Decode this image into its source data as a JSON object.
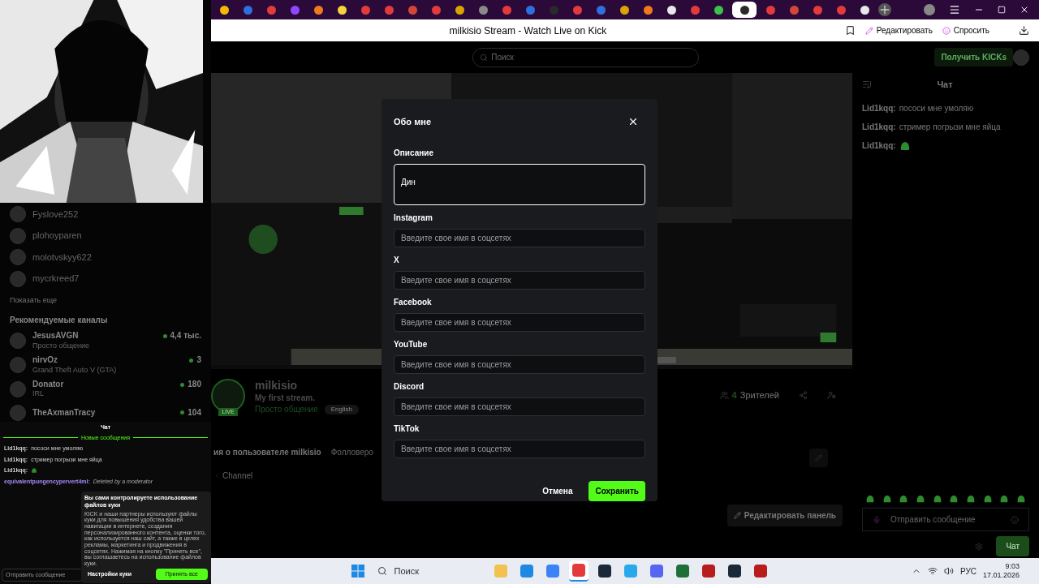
{
  "browser": {
    "tabs": [
      {
        "kind": "star",
        "selected": false
      },
      {
        "kind": "blue",
        "selected": false
      },
      {
        "kind": "ya",
        "selected": false
      },
      {
        "kind": "purple",
        "selected": false
      },
      {
        "kind": "orange",
        "selected": false
      },
      {
        "kind": "yellow",
        "selected": false
      },
      {
        "kind": "ya",
        "selected": false
      },
      {
        "kind": "ya",
        "selected": false
      },
      {
        "kind": "mail",
        "selected": false
      },
      {
        "kind": "ya",
        "selected": false
      },
      {
        "kind": "gold",
        "selected": false
      },
      {
        "kind": "grey",
        "selected": false
      },
      {
        "kind": "ya",
        "selected": false
      },
      {
        "kind": "blue",
        "selected": false
      },
      {
        "kind": "dark",
        "selected": false
      },
      {
        "kind": "ya",
        "selected": false
      },
      {
        "kind": "blue",
        "selected": false
      },
      {
        "kind": "gold",
        "selected": false
      },
      {
        "kind": "orange",
        "selected": false
      },
      {
        "kind": "doc",
        "selected": false
      },
      {
        "kind": "ya",
        "selected": false
      },
      {
        "kind": "green",
        "selected": false
      },
      {
        "kind": "dark",
        "selected": true
      },
      {
        "kind": "ya",
        "selected": false
      },
      {
        "kind": "mail",
        "selected": false
      },
      {
        "kind": "ya",
        "selected": false
      },
      {
        "kind": "ya",
        "selected": false
      },
      {
        "kind": "doc",
        "selected": false
      }
    ],
    "page_title": "milkisio Stream - Watch Live on Kick",
    "edit_button": "Редактировать",
    "ask_button": "Спросить"
  },
  "header": {
    "search_placeholder": "Поиск",
    "kicks_button": "Получить KICKs"
  },
  "sidebar": {
    "followed": [
      {
        "name": "Fyslove252"
      },
      {
        "name": "plohoyparen"
      },
      {
        "name": "molotvskyy622"
      },
      {
        "name": "mycrkreed7"
      }
    ],
    "show_more": "Показать еще",
    "recommended_title": "Рекомендуемые каналы",
    "recommended": [
      {
        "name": "JesusAVGN",
        "category": "Просто общение",
        "viewers": "4,4 тыс."
      },
      {
        "name": "nirvOz",
        "category": "Grand Theft Auto V (GTA)",
        "viewers": "3"
      },
      {
        "name": "Donator",
        "category": "IRL",
        "viewers": "180"
      },
      {
        "name": "TheAxmanTracy",
        "viewers": "104"
      }
    ]
  },
  "mini_chat": {
    "title": "Чат",
    "new_messages": "Новые сообщения",
    "messages": [
      {
        "kind": "text",
        "user": "Lid1kqq:",
        "text": "пососи мне умоляю"
      },
      {
        "kind": "text",
        "user": "Lid1kqq:",
        "text": "стример погрызи мне яйца"
      },
      {
        "kind": "emote",
        "user": "Lid1kqq:"
      },
      {
        "kind": "deleted",
        "user": "equivalentpungencypervert4ml:",
        "text": "Deleted by a moderator"
      }
    ],
    "input_placeholder": "Отправить сообщение"
  },
  "cookie": {
    "title": "Вы сами контролируете использование файлов куки",
    "body": "KICK и наши партнеры используют файлы куки для повышения удобства вашей навигации в интернете, создания персонализированного контента, оценки того, как используется наш сайт, а также в целях рекламы, маркетинга и продвижения в соцсетях. Нажимая на кнопку \"Принять все\", вы соглашаетесь на использование файлов куки.",
    "settings_button": "Настройки куки",
    "accept_button": "Принять все"
  },
  "channel": {
    "live_badge": "LIVE",
    "name": "milkisio",
    "stream_title": "My first stream.",
    "category": "Просто общение",
    "language": "English",
    "viewer_count": "4",
    "viewer_label": "Зрителей",
    "about_title": "ия о пользователе milkisio",
    "followers_tab": "Фолловеро",
    "channel_link": "Channel",
    "edit_panel_button": "Редактировать панель"
  },
  "chat": {
    "title": "Чат",
    "messages": [
      {
        "kind": "text",
        "user": "Lid1kqq:",
        "text": "пососи мне умоляю"
      },
      {
        "kind": "text",
        "user": "Lid1kqq:",
        "text": "стример погрызи мне яйца"
      },
      {
        "kind": "emote",
        "user": "Lid1kqq:"
      }
    ],
    "input_placeholder": "Отправить сообщение",
    "send_button": "Чат"
  },
  "modal": {
    "title": "Обо мне",
    "fields": [
      {
        "kind": "textarea",
        "label": "Описание",
        "value": "Дин",
        "focused": true
      },
      {
        "kind": "input",
        "label": "Instagram",
        "placeholder": "Введите свое имя в соцсетях",
        "focused": false
      },
      {
        "kind": "input",
        "label": "X",
        "placeholder": "Введите свое имя в соцсетях",
        "focused": false
      },
      {
        "kind": "input",
        "label": "Facebook",
        "placeholder": "Введите свое имя в соцсетях",
        "focused": false
      },
      {
        "kind": "input",
        "label": "YouTube",
        "placeholder": "Введите свое имя в соцсетях",
        "focused": false
      },
      {
        "kind": "input",
        "label": "Discord",
        "placeholder": "Введите свое имя в соцсетях",
        "focused": false
      },
      {
        "kind": "input",
        "label": "TikTok",
        "placeholder": "Введите свое имя в соцсетях",
        "focused": false
      }
    ],
    "cancel_button": "Отмена",
    "save_button": "Сохранить"
  },
  "taskbar": {
    "apps": [
      {
        "kind": "folder",
        "selected": false
      },
      {
        "kind": "edge",
        "selected": false
      },
      {
        "kind": "store",
        "selected": false
      },
      {
        "kind": "ya",
        "selected": true
      },
      {
        "kind": "steam",
        "selected": false
      },
      {
        "kind": "telegram",
        "selected": false
      },
      {
        "kind": "discord",
        "selected": false
      },
      {
        "kind": "green",
        "selected": false
      },
      {
        "kind": "red",
        "selected": false
      },
      {
        "kind": "steam",
        "selected": false
      },
      {
        "kind": "red",
        "selected": false
      }
    ],
    "search_placeholder": "Поиск",
    "language": "РУС",
    "time": "9:03",
    "date": "17.01.2026"
  }
}
